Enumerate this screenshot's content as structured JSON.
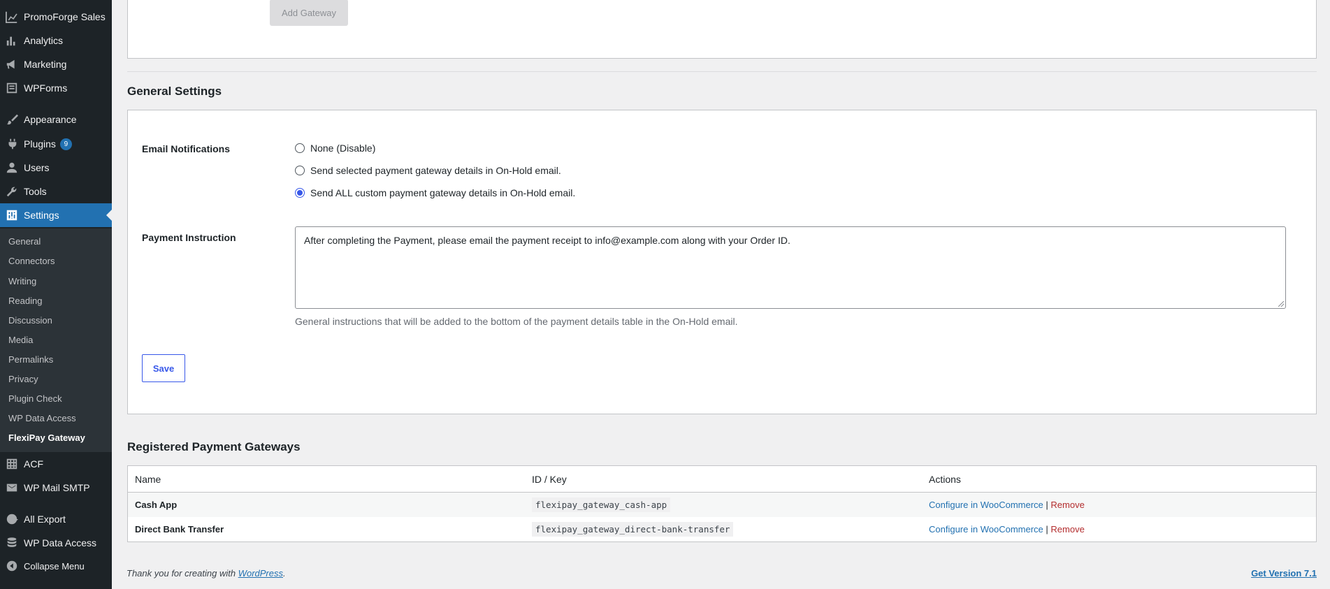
{
  "sidebar": {
    "items": [
      {
        "label": "PromoForge Sales",
        "icon": "chart-line-icon"
      },
      {
        "label": "Analytics",
        "icon": "bar-chart-icon"
      },
      {
        "label": "Marketing",
        "icon": "megaphone-icon"
      },
      {
        "label": "WPForms",
        "icon": "form-icon"
      },
      {
        "label": "Appearance",
        "icon": "paintbrush-icon"
      },
      {
        "label": "Plugins",
        "icon": "plug-icon",
        "badge": "9"
      },
      {
        "label": "Users",
        "icon": "user-icon"
      },
      {
        "label": "Tools",
        "icon": "wrench-icon"
      },
      {
        "label": "Settings",
        "icon": "settings-icon"
      },
      {
        "label": "ACF",
        "icon": "grid-icon"
      },
      {
        "label": "WP Mail SMTP",
        "icon": "mail-icon"
      },
      {
        "label": "All Export",
        "icon": "export-icon"
      },
      {
        "label": "WP Data Access",
        "icon": "database-icon"
      },
      {
        "label": "Collapse Menu",
        "icon": "collapse-icon"
      }
    ],
    "submenu": [
      "General",
      "Connectors",
      "Writing",
      "Reading",
      "Discussion",
      "Media",
      "Permalinks",
      "Privacy",
      "Plugin Check",
      "WP Data Access",
      "FlexiPay Gateway"
    ]
  },
  "top": {
    "add_gateway_label": "Add Gateway"
  },
  "general": {
    "title": "General Settings",
    "email_label": "Email Notifications",
    "options": [
      {
        "label": "None (Disable)",
        "checked": false
      },
      {
        "label": "Send selected payment gateway details in On-Hold email.",
        "checked": false
      },
      {
        "label": "Send ALL custom payment gateway details in On-Hold email.",
        "checked": true
      }
    ],
    "instruction_label": "Payment Instruction",
    "instruction_value": "After completing the Payment, please email the payment receipt to info@example.com along with your Order ID.",
    "instruction_desc": "General instructions that will be added to the bottom of the payment details table in the On-Hold email.",
    "save_label": "Save"
  },
  "registered": {
    "title": "Registered Payment Gateways",
    "columns": [
      "Name",
      "ID / Key",
      "Actions"
    ],
    "rows": [
      {
        "name": "Cash App",
        "key": "flexipay_gateway_cash-app",
        "configure": "Configure in WooCommerce",
        "sep": "|",
        "remove": "Remove"
      },
      {
        "name": "Direct Bank Transfer",
        "key": "flexipay_gateway_direct-bank-transfer",
        "configure": "Configure in WooCommerce",
        "sep": "|",
        "remove": "Remove"
      }
    ]
  },
  "footer": {
    "thanks_prefix": "Thank you for creating with ",
    "wp_link": "WordPress",
    "thanks_suffix": ".",
    "version_link": "Get Version 7.1"
  }
}
